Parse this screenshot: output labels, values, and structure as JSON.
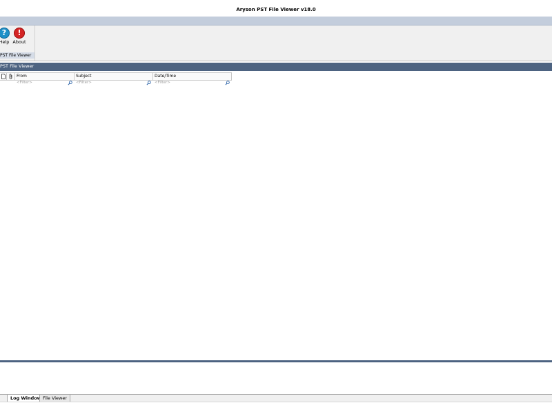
{
  "window": {
    "title": "Aryson PST File Viewer v18.0"
  },
  "ribbon": {
    "buttons": [
      {
        "label": "Help",
        "icon": "help-icon"
      },
      {
        "label": "About",
        "icon": "about-icon"
      }
    ],
    "group_label": "PST File Viewer"
  },
  "panel": {
    "title": "PST File Viewer"
  },
  "grid": {
    "columns": [
      "",
      "",
      "From",
      "Subject",
      "Date/Time"
    ],
    "filter_placeholder": "<Filter>"
  },
  "tabs": [
    {
      "label": "Log Window",
      "active": true
    },
    {
      "label": "File Viewer",
      "active": false
    }
  ],
  "colors": {
    "panel_header": "#4d6381",
    "ribbon_bar": "#c3cddc"
  }
}
